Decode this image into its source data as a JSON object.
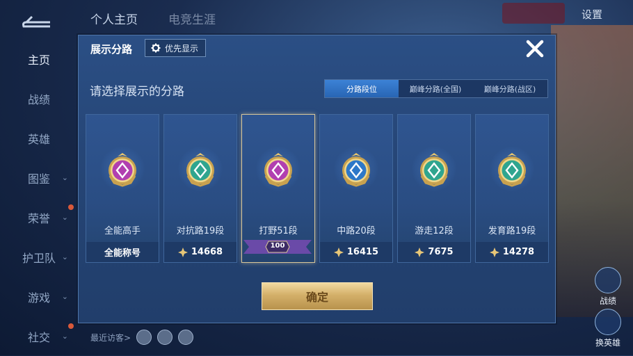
{
  "background": {
    "tabs": [
      "个人主页",
      "电竞生涯"
    ],
    "settings": "设置",
    "sidebar": [
      {
        "label": "主页",
        "active": true,
        "chevron": false,
        "dot": false
      },
      {
        "label": "战绩",
        "active": false,
        "chevron": false,
        "dot": false
      },
      {
        "label": "英雄",
        "active": false,
        "chevron": false,
        "dot": false
      },
      {
        "label": "图鉴",
        "active": false,
        "chevron": true,
        "dot": false
      },
      {
        "label": "荣誉",
        "active": false,
        "chevron": true,
        "dot": true
      },
      {
        "label": "护卫队",
        "active": false,
        "chevron": true,
        "dot": false
      },
      {
        "label": "游戏",
        "active": false,
        "chevron": true,
        "dot": false
      },
      {
        "label": "社交",
        "active": false,
        "chevron": true,
        "dot": true
      }
    ],
    "visitors_label": "最近访客>",
    "side_buttons": [
      "战绩",
      "换英雄"
    ]
  },
  "modal": {
    "title": "展示分路",
    "priority_label": "优先显示",
    "subtitle": "请选择展示的分路",
    "tabs": [
      "分路段位",
      "巅峰分路(全国)",
      "巅峰分路(战区)"
    ],
    "active_tab": 0,
    "cards": [
      {
        "label": "全能高手",
        "bar_text": "全能称号",
        "has_star": false,
        "icon": "all-round-emblem-icon",
        "color": "#b13fb0"
      },
      {
        "label": "对抗路19段",
        "bar_text": "14668",
        "has_star": true,
        "icon": "clash-lane-emblem-icon",
        "color": "#2fa58f"
      },
      {
        "label": "打野51段",
        "bar_text": "",
        "has_star": false,
        "icon": "jungle-emblem-icon",
        "color": "#b13fb0",
        "selected": true,
        "ribbon": "100"
      },
      {
        "label": "中路20段",
        "bar_text": "16415",
        "has_star": true,
        "icon": "mid-lane-emblem-icon",
        "color": "#2e78c8"
      },
      {
        "label": "游走12段",
        "bar_text": "7675",
        "has_star": true,
        "icon": "roam-emblem-icon",
        "color": "#2fa58f"
      },
      {
        "label": "发育路19段",
        "bar_text": "14278",
        "has_star": true,
        "icon": "farm-lane-emblem-icon",
        "color": "#2fa58f"
      }
    ],
    "confirm_label": "确定"
  }
}
